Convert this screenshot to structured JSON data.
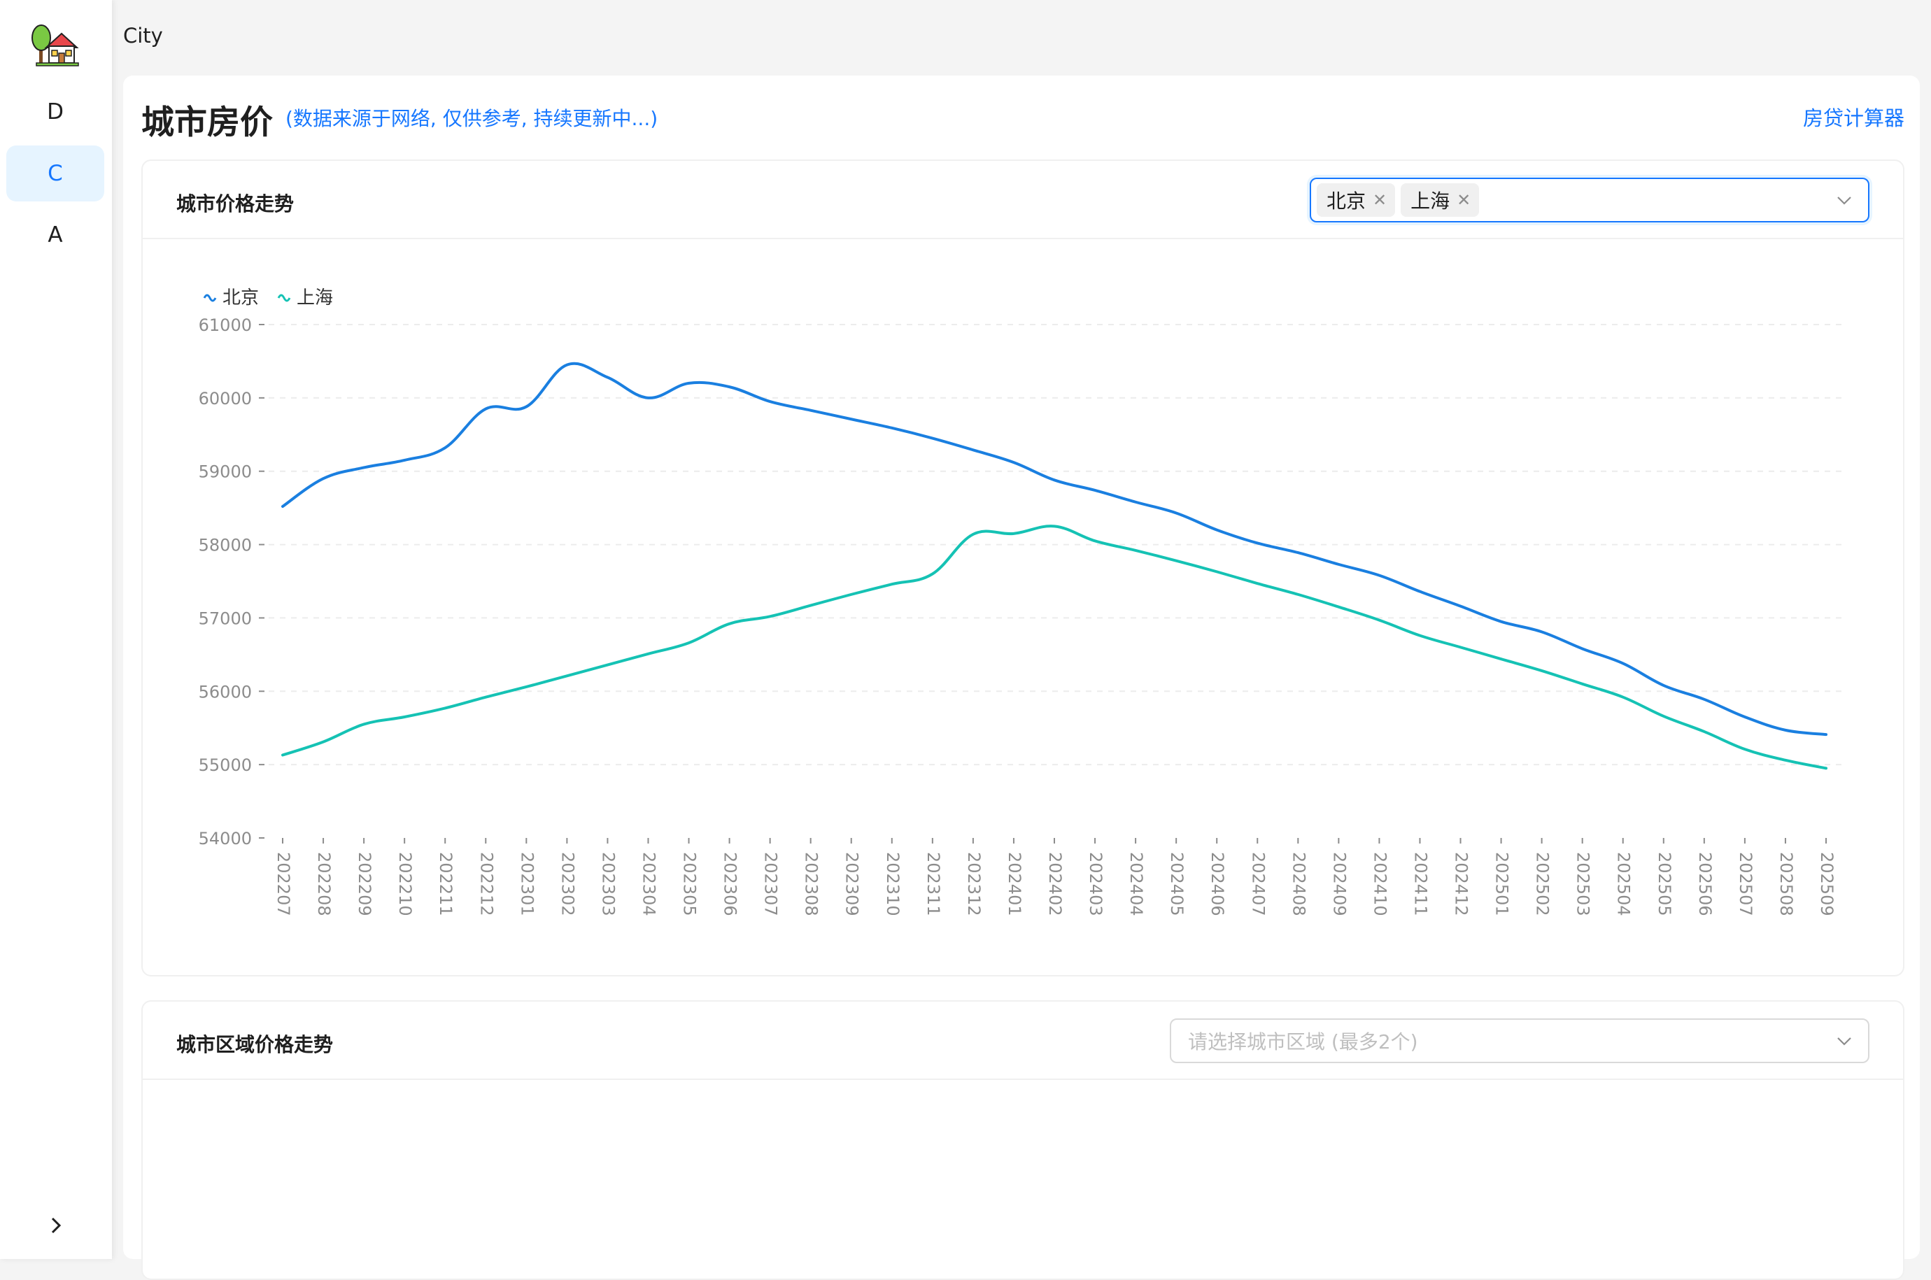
{
  "app": {
    "header_title": "City"
  },
  "sidebar": {
    "items": [
      {
        "label": "D",
        "active": false
      },
      {
        "label": "C",
        "active": true
      },
      {
        "label": "A",
        "active": false
      }
    ]
  },
  "page": {
    "title": "城市房价",
    "subtitle": "(数据来源于网络, 仅供参考, 持续更新中...)",
    "calc_link": "房贷计算器"
  },
  "city_panel": {
    "title": "城市价格走势",
    "selected": [
      "北京",
      "上海"
    ]
  },
  "district_panel": {
    "title": "城市区域价格走势",
    "placeholder": "请选择城市区域 (最多2个)"
  },
  "colors": {
    "accent": "#1677ff",
    "beijing": "#1a7fe0",
    "shanghai": "#15c2b4",
    "active_bg": "#e6f4ff"
  },
  "chart_data": {
    "type": "line",
    "categories": [
      "202207",
      "202208",
      "202209",
      "202210",
      "202211",
      "202212",
      "202301",
      "202302",
      "202303",
      "202304",
      "202305",
      "202306",
      "202307",
      "202308",
      "202309",
      "202310",
      "202311",
      "202312",
      "202401",
      "202402",
      "202403",
      "202404",
      "202405",
      "202406",
      "202407",
      "202408",
      "202409",
      "202410",
      "202411",
      "202412",
      "202501",
      "202502",
      "202503",
      "202504",
      "202505",
      "202506",
      "202507",
      "202508",
      "202509"
    ],
    "series": [
      {
        "name": "北京",
        "color": "#1a7fe0",
        "values": [
          58520,
          58900,
          59050,
          59150,
          59320,
          59850,
          59880,
          60450,
          60280,
          60000,
          60200,
          60150,
          59950,
          59830,
          59710,
          59590,
          59450,
          59290,
          59120,
          58880,
          58740,
          58580,
          58430,
          58200,
          58020,
          57890,
          57730,
          57580,
          57360,
          57160,
          56950,
          56810,
          56580,
          56380,
          56080,
          55890,
          55650,
          55470,
          55410
        ]
      },
      {
        "name": "上海",
        "color": "#15c2b4",
        "values": [
          55130,
          55310,
          55550,
          55650,
          55770,
          55920,
          56060,
          56210,
          56360,
          56510,
          56660,
          56920,
          57020,
          57170,
          57320,
          57460,
          57600,
          58140,
          58150,
          58250,
          58050,
          57920,
          57780,
          57630,
          57470,
          57320,
          57150,
          56970,
          56760,
          56600,
          56440,
          56280,
          56100,
          55920,
          55660,
          55450,
          55210,
          55060,
          54950
        ]
      }
    ],
    "yticks": [
      54000,
      55000,
      56000,
      57000,
      58000,
      59000,
      60000,
      61000
    ],
    "ylim": [
      54000,
      61000
    ],
    "legend": "top-left",
    "grid": true
  }
}
